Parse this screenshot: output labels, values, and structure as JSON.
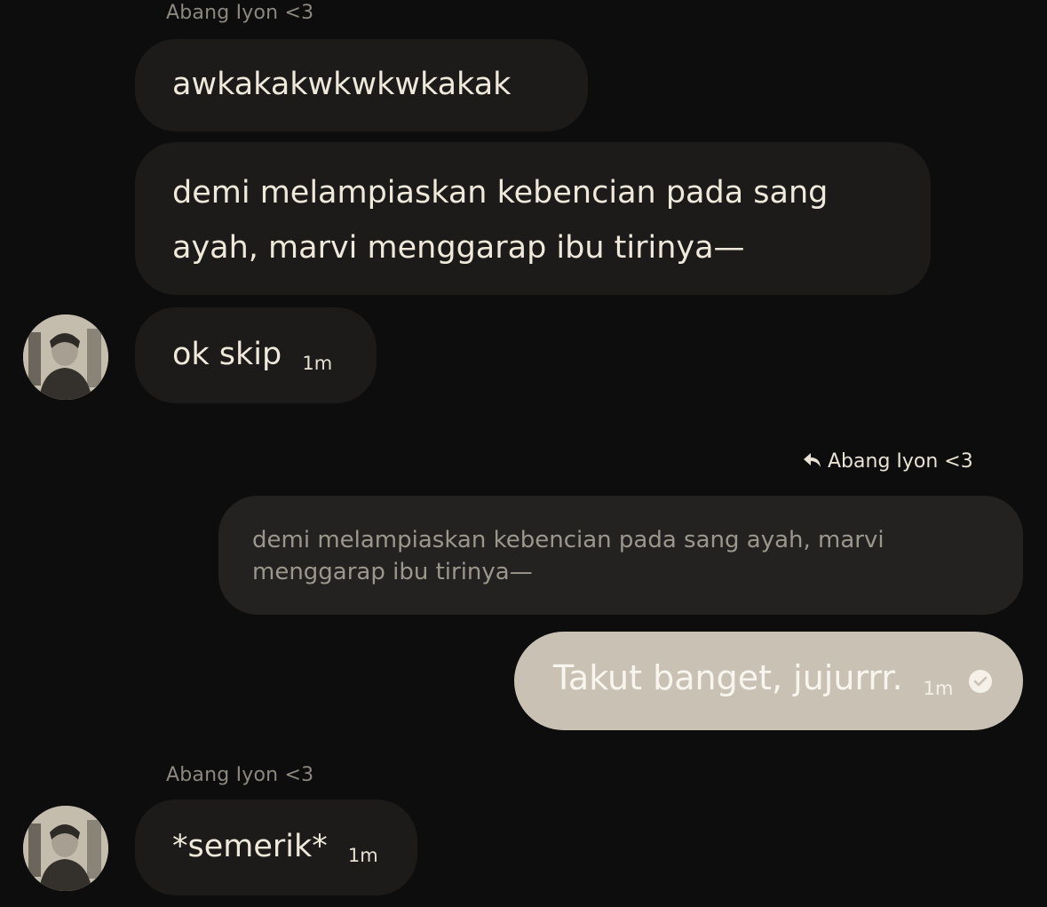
{
  "sender_name": "Abang Iyon <3",
  "messages_top": [
    {
      "text": "awkakakwkwkwkakak"
    },
    {
      "lines": [
        "demi melampiaskan kebencian pada sang",
        "ayah, marvi menggarap ibu tirinya—"
      ]
    },
    {
      "text": "ok skip",
      "time": "1m"
    }
  ],
  "reply": {
    "label": "Abang Iyon <3",
    "quote_lines": [
      "demi melampiaskan kebencian pada sang ayah, marvi",
      "menggarap ibu tirinya—"
    ],
    "text": "Takut banget, jujurrr.",
    "time": "1m"
  },
  "messages_bottom": [
    {
      "text": "*semerik*",
      "time": "1m"
    }
  ],
  "colors": {
    "background": "#0d0d0d",
    "incoming_bubble": "#1c1b1a",
    "outgoing_bubble": "#c9c2b4"
  },
  "icons": [
    "reply-arrow-icon",
    "read-check-icon",
    "avatar"
  ]
}
